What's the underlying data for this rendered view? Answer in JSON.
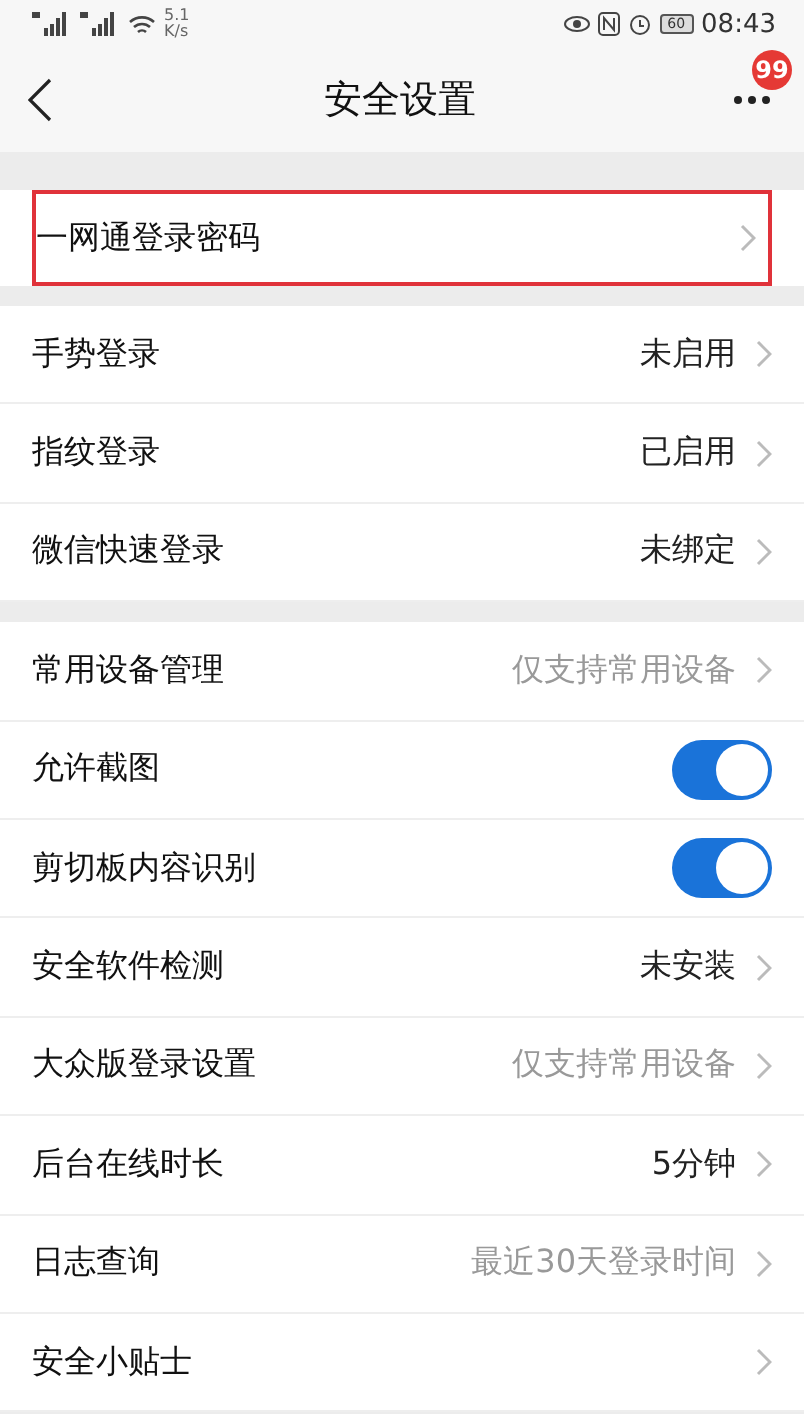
{
  "status_bar": {
    "speed": "5.1",
    "speed_unit": "K/s",
    "battery": "60",
    "time": "08:43"
  },
  "nav": {
    "title": "安全设置",
    "badge": "99"
  },
  "sections": [
    {
      "rows": [
        {
          "kind": "link",
          "label": "一网通登录密码",
          "highlighted": true
        }
      ]
    },
    {
      "rows": [
        {
          "kind": "link",
          "label": "手势登录",
          "value": "未启用",
          "dim": false,
          "highlighted": false
        },
        {
          "kind": "link",
          "label": "指纹登录",
          "value": "已启用",
          "dim": false,
          "highlighted": false
        },
        {
          "kind": "link",
          "label": "微信快速登录",
          "value": "未绑定",
          "dim": false,
          "highlighted": false
        }
      ]
    },
    {
      "rows": [
        {
          "kind": "link",
          "label": "常用设备管理",
          "value": "仅支持常用设备",
          "dim": true,
          "highlighted": false
        },
        {
          "kind": "toggle",
          "label": "允许截图",
          "on": true
        },
        {
          "kind": "toggle",
          "label": "剪切板内容识别",
          "on": true
        },
        {
          "kind": "link",
          "label": "安全软件检测",
          "value": "未安装",
          "dim": false,
          "highlighted": false
        },
        {
          "kind": "link",
          "label": "大众版登录设置",
          "value": "仅支持常用设备",
          "dim": true,
          "highlighted": false
        },
        {
          "kind": "link",
          "label": "后台在线时长",
          "value": "5分钟",
          "dim": false,
          "highlighted": false
        },
        {
          "kind": "link",
          "label": "日志查询",
          "value": "最近30天登录时间",
          "dim": true,
          "highlighted": false
        },
        {
          "kind": "link",
          "label": "安全小贴士",
          "highlighted": false
        }
      ]
    }
  ]
}
